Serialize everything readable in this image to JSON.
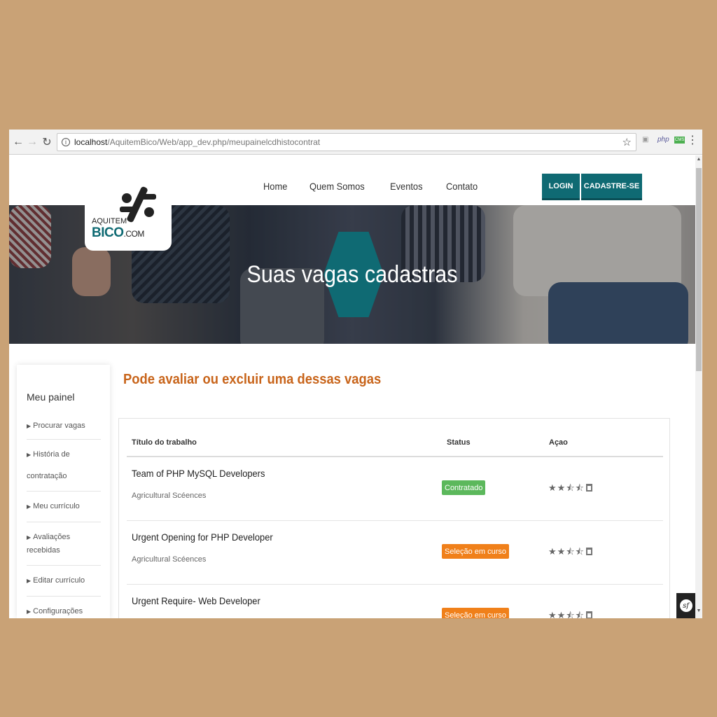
{
  "browser": {
    "url_host": "localhost",
    "url_path": "/AquitemBico/Web/app_dev.php/meupainelcdhistocontrat",
    "ext_php": "php",
    "ext_cms": "CMS"
  },
  "logo": {
    "top": "AQUITEM",
    "main": "BICO",
    "suffix": ".COM"
  },
  "nav": {
    "items": [
      "Home",
      "Quem Somos",
      "Eventos",
      "Contato"
    ],
    "login": "LOGIN",
    "signup": "CADASTRE-SE"
  },
  "hero": {
    "title": "Suas vagas cadastras"
  },
  "sidebar": {
    "title": "Meu painel",
    "items": [
      "Procurar vagas",
      "História de contratação",
      "Meu currículo",
      "Avaliações recebidas",
      "Editar currículo",
      "Configurações"
    ]
  },
  "main": {
    "heading": "Pode avaliar ou excluir uma dessas vagas",
    "columns": [
      "Título do trabalho",
      "Status",
      "Açao"
    ],
    "jobs": [
      {
        "title": "Team of PHP MySQL Developers",
        "category": "Agricultural Scéences",
        "status": "Contratado",
        "status_color": "#5cb85c",
        "rating": 2.5
      },
      {
        "title": "Urgent Opening for PHP Developer",
        "category": "Agricultural Scéences",
        "status": "Seleção em curso",
        "status_color": "#f0801a",
        "rating": 2.5
      },
      {
        "title": "Urgent Require- Web Developer",
        "category": "",
        "status": "Seleção em curso",
        "status_color": "#f0801a",
        "rating": 2.5
      }
    ]
  },
  "colors": {
    "brand": "#0f6a73",
    "accent": "#c8641a",
    "page_bg": "#c9a276"
  }
}
